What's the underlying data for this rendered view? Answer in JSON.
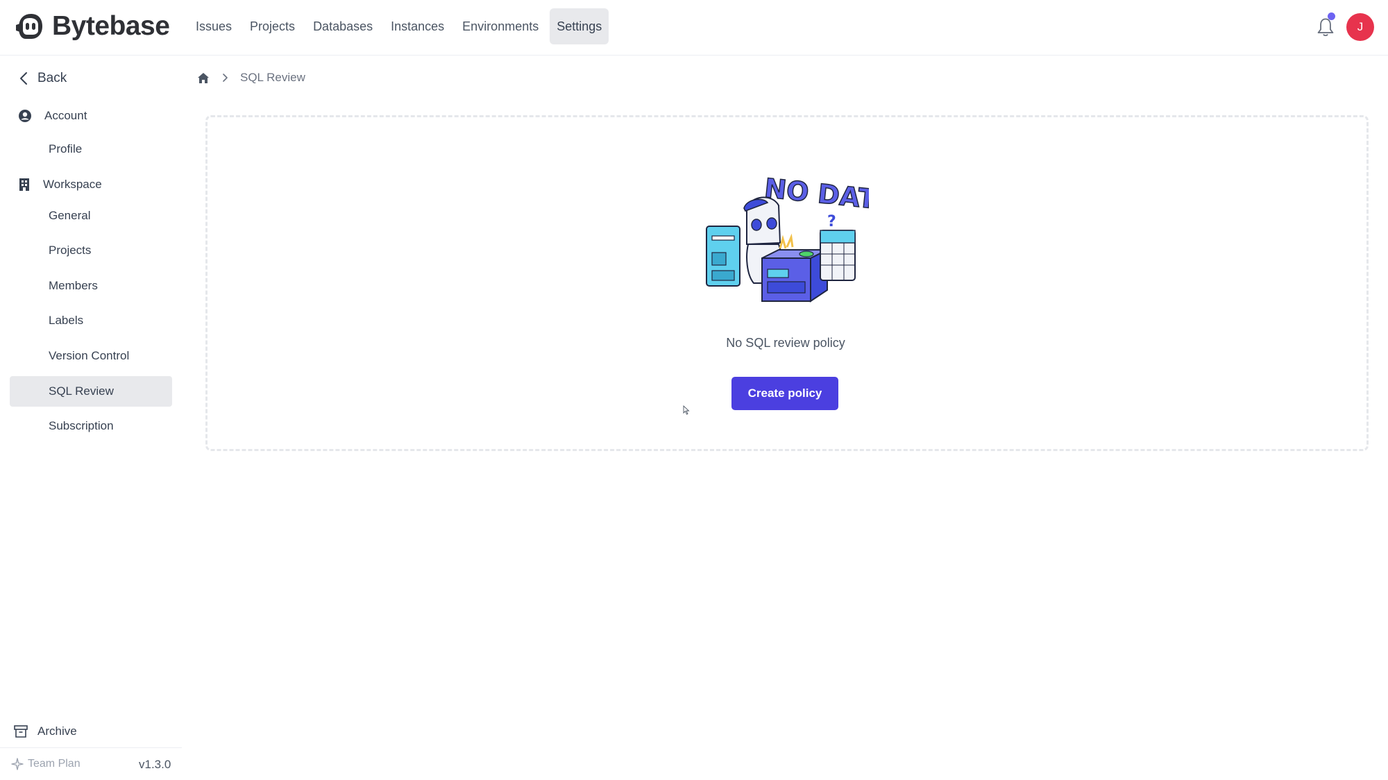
{
  "app": {
    "logo_text": "Bytebase",
    "nav": [
      {
        "label": "Issues"
      },
      {
        "label": "Projects"
      },
      {
        "label": "Databases"
      },
      {
        "label": "Instances"
      },
      {
        "label": "Environments"
      },
      {
        "label": "Settings",
        "active": true
      }
    ],
    "avatar_initial": "J",
    "notification_icon": "bell-icon",
    "accent_color": "#4b3fe0",
    "avatar_color": "#e7334d"
  },
  "sidebar": {
    "back_label": "Back",
    "account": {
      "label": "Account",
      "icon": "user-circle-icon",
      "items": [
        {
          "label": "Profile"
        }
      ]
    },
    "workspace": {
      "label": "Workspace",
      "icon": "building-icon",
      "items": [
        {
          "label": "General"
        },
        {
          "label": "Projects"
        },
        {
          "label": "Members"
        },
        {
          "label": "Labels"
        },
        {
          "label": "Version Control"
        },
        {
          "label": "SQL Review",
          "active": true
        },
        {
          "label": "Subscription"
        }
      ]
    },
    "archive_label": "Archive",
    "plan_label": "Team Plan",
    "version": "v1.3.0"
  },
  "main": {
    "breadcrumb": {
      "current": "SQL Review"
    },
    "empty_state": {
      "illustration_text": "NO DATA",
      "message": "No SQL review policy",
      "button_label": "Create policy"
    }
  }
}
